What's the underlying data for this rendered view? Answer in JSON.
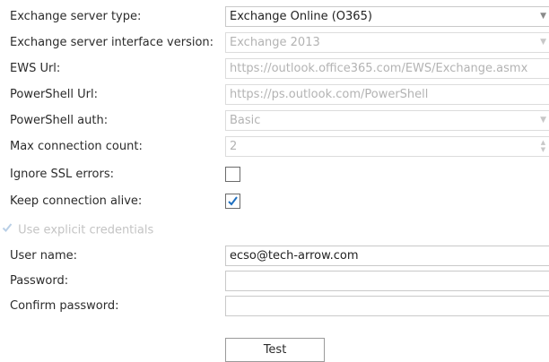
{
  "form": {
    "server_type": {
      "label": "Exchange server type:",
      "value": "Exchange Online (O365)"
    },
    "interface_version": {
      "label": "Exchange server interface version:",
      "value": "Exchange 2013"
    },
    "ews_url": {
      "label": "EWS Url:",
      "value": "https://outlook.office365.com/EWS/Exchange.asmx"
    },
    "powershell_url": {
      "label": "PowerShell Url:",
      "value": "https://ps.outlook.com/PowerShell"
    },
    "powershell_auth": {
      "label": "PowerShell auth:",
      "value": "Basic"
    },
    "max_connection": {
      "label": "Max connection count:",
      "value": "2"
    },
    "ignore_ssl": {
      "label": "Ignore SSL errors:",
      "checked": false
    },
    "keep_alive": {
      "label": "Keep connection alive:",
      "checked": true
    },
    "explicit_credentials": {
      "label": "Use explicit credentials",
      "checked": true,
      "disabled": true
    },
    "user_name": {
      "label": "User name:",
      "value": "ecso@tech-arrow.com"
    },
    "password": {
      "label": "Password:",
      "value": ""
    },
    "confirm_password": {
      "label": "Confirm password:",
      "value": ""
    }
  },
  "test_button": {
    "label": "Test"
  },
  "icons": {
    "dropdown": "chevron-down-icon",
    "check": "checkmark-icon",
    "spinner": "spin-arrows-icon"
  },
  "colors": {
    "checkmark": "#1e6fc0",
    "disabled_text": "#b3b3b3",
    "border": "#c9c9c9"
  }
}
